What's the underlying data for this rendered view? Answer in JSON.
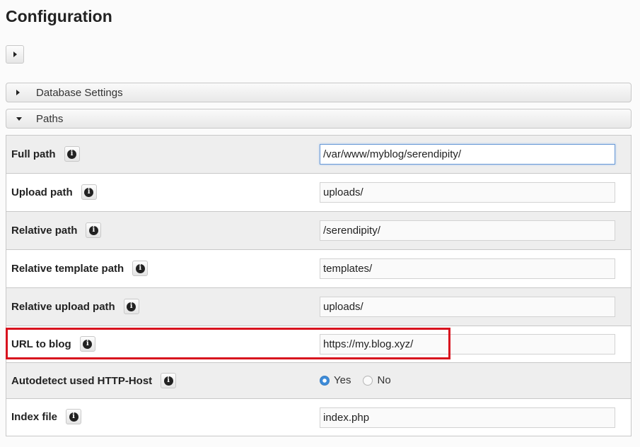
{
  "page_title": "Configuration",
  "sections": {
    "database": {
      "label": "Database Settings",
      "expanded": false
    },
    "paths": {
      "label": "Paths",
      "expanded": true
    }
  },
  "rows": [
    {
      "label": "Full path",
      "value": "/var/www/myblog/serendipity/"
    },
    {
      "label": "Upload path",
      "value": "uploads/"
    },
    {
      "label": "Relative path",
      "value": "/serendipity/"
    },
    {
      "label": "Relative template path",
      "value": "templates/"
    },
    {
      "label": "Relative upload path",
      "value": "uploads/"
    },
    {
      "label": "URL to blog",
      "value": "https://my.blog.xyz/"
    },
    {
      "label": "Autodetect used HTTP-Host",
      "options": [
        "Yes",
        "No"
      ],
      "selected": "Yes"
    },
    {
      "label": "Index file",
      "value": "index.php"
    }
  ],
  "icons": {
    "info": "info-icon",
    "toggle": "caret-right-icon"
  },
  "colors": {
    "highlight": "#d8121e",
    "radio_selected": "#3d8bd8",
    "focus_border": "#6a9ad6"
  }
}
